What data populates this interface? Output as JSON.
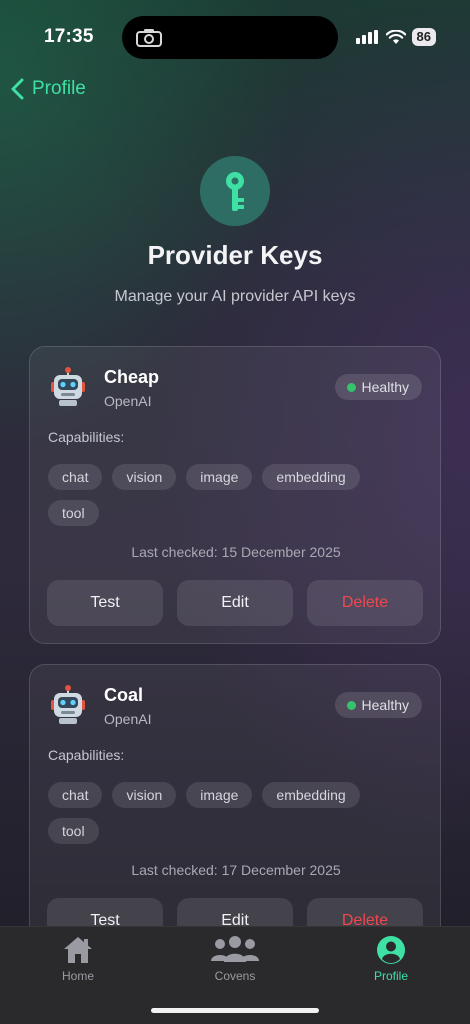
{
  "status": {
    "time": "17:35",
    "battery": "86"
  },
  "nav": {
    "back_label": "Profile"
  },
  "header": {
    "title": "Provider Keys",
    "subtitle": "Manage your AI provider API keys"
  },
  "keys": [
    {
      "name": "Cheap",
      "provider": "OpenAI",
      "status": "Healthy",
      "capabilities_label": "Capabilities:",
      "capabilities": [
        "chat",
        "vision",
        "image",
        "embedding",
        "tool"
      ],
      "last_checked": "Last checked: 15 December 2025",
      "actions": {
        "test": "Test",
        "edit": "Edit",
        "delete": "Delete"
      }
    },
    {
      "name": "Coal",
      "provider": "OpenAI",
      "status": "Healthy",
      "capabilities_label": "Capabilities:",
      "capabilities": [
        "chat",
        "vision",
        "image",
        "embedding",
        "tool"
      ],
      "last_checked": "Last checked: 17 December 2025",
      "actions": {
        "test": "Test",
        "edit": "Edit",
        "delete": "Delete"
      }
    }
  ],
  "tabbar": {
    "items": [
      {
        "label": "Home",
        "icon": "house-icon",
        "active": false
      },
      {
        "label": "Covens",
        "icon": "group-icon",
        "active": false
      },
      {
        "label": "Profile",
        "icon": "profile-icon",
        "active": true
      }
    ]
  },
  "colors": {
    "accent": "#3fe0a4",
    "danger": "#f0474f",
    "healthy": "#35c46b"
  }
}
